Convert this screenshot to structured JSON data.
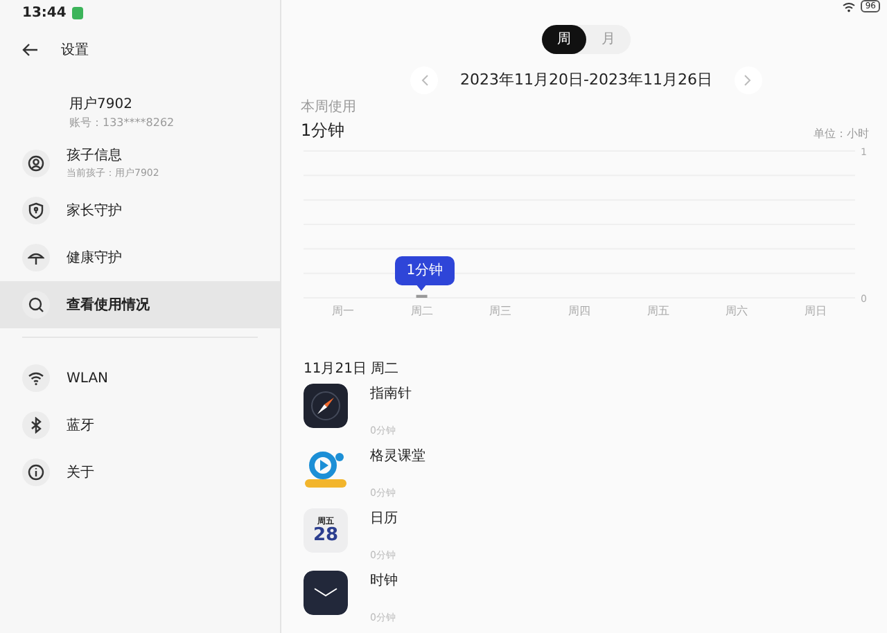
{
  "status_bar": {
    "time": "13:44",
    "battery": "96"
  },
  "header": {
    "title": "设置"
  },
  "profile": {
    "name": "用户7902",
    "account": "账号：133****8262"
  },
  "sidebar": {
    "groups": [
      {
        "items": [
          {
            "label": "孩子信息",
            "subtitle": "当前孩子：用户7902",
            "selected": false
          },
          {
            "label": "家长守护",
            "selected": false
          },
          {
            "label": "健康守护",
            "selected": false
          },
          {
            "label": "查看使用情况",
            "selected": true
          }
        ]
      },
      {
        "items": [
          {
            "label": "WLAN",
            "selected": false
          },
          {
            "label": "蓝牙",
            "selected": false
          },
          {
            "label": "关于",
            "selected": false
          }
        ]
      }
    ]
  },
  "period_tabs": [
    {
      "label": "周",
      "selected": true
    },
    {
      "label": "月",
      "selected": false
    }
  ],
  "date_range": "2023年11月20日-2023年11月26日",
  "usage": {
    "caption": "本周使用",
    "total": "1分钟",
    "unit": "单位：小时",
    "chart_data": {
      "type": "bar",
      "categories": [
        "周一",
        "周二",
        "周三",
        "周四",
        "周五",
        "周六",
        "周日"
      ],
      "values": [
        0,
        0.02,
        0,
        0,
        0,
        0,
        0
      ],
      "ylim": [
        0,
        1
      ],
      "yticks": [
        0,
        1
      ],
      "annotations": [
        "1分钟"
      ]
    }
  },
  "day": {
    "title": "11月21日 周二",
    "apps": [
      {
        "name": "指南针",
        "time": "0分钟"
      },
      {
        "name": "格灵课堂",
        "time": "0分钟"
      },
      {
        "name": "日历",
        "time": "0分钟",
        "icon_text": [
          "周五",
          "28"
        ]
      },
      {
        "name": "时钟",
        "time": "0分钟"
      }
    ]
  }
}
